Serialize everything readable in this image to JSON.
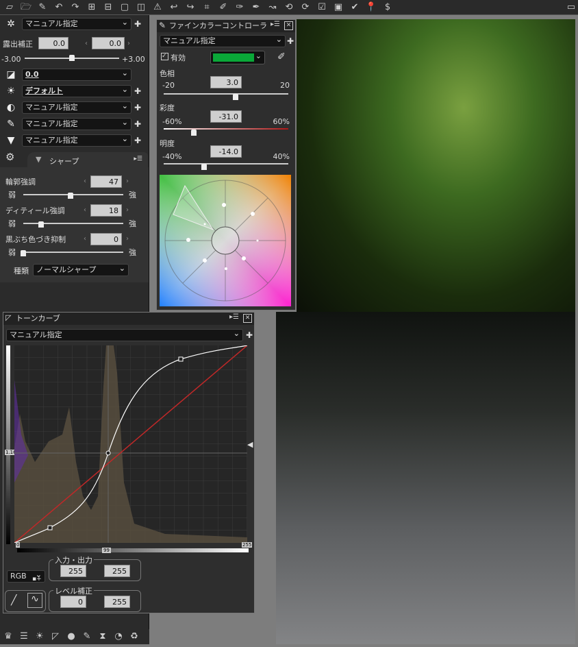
{
  "toolbar": {
    "icons": [
      "new-icon",
      "open-icon",
      "brush-icon",
      "undo-icon",
      "redo-icon",
      "grid4-icon",
      "grid2-icon",
      "single-view-icon",
      "split-view-icon",
      "warning-icon",
      "back-icon",
      "forward-icon",
      "crop-icon",
      "picker-icon",
      "picker2-icon",
      "pen-icon",
      "curve-icon",
      "rotate-left-icon",
      "rotate-right-icon",
      "check-icon",
      "save-icon",
      "approve-icon",
      "pin-icon",
      "dollar-icon",
      "monitor-icon"
    ]
  },
  "left": {
    "picture_control": "マニュアル指定",
    "exposure_label": "露出補正",
    "exposure_value1": "0.0",
    "exposure_value2": "0.0",
    "exposure_min": "-3.00",
    "exposure_max": "+3.00",
    "exposure_pos": 0.5,
    "exp_comp_select": "0.0",
    "wb_select": "デフォルト",
    "contrast_select": "マニュアル指定",
    "color_select": "マニュアル指定",
    "sharp_select": "マニュアル指定",
    "sharp_tab": "シャープ",
    "outline_label": "輪郭強調",
    "outline_value": "47",
    "outline_pos": 0.47,
    "detail_label": "ディティール強調",
    "detail_value": "18",
    "detail_pos": 0.18,
    "fringe_label": "黒ぶち色づき抑制",
    "fringe_value": "0",
    "fringe_pos": 0,
    "weak": "弱",
    "strong": "強",
    "type_label": "種類",
    "type_value": "ノーマルシャープ"
  },
  "fcc": {
    "title": "ファインカラーコントローラ",
    "preset": "マニュアル指定",
    "enabled_label": "有効",
    "swatch_color": "#0aa838",
    "hue_label": "色相",
    "hue_value": "3.0",
    "hue_min": "-20",
    "hue_max": "20",
    "hue_pos": 0.575,
    "sat_label": "彩度",
    "sat_value": "-31.0",
    "sat_min": "-60%",
    "sat_max": "60%",
    "sat_pos": 0.24,
    "bri_label": "明度",
    "bri_value": "-14.0",
    "bri_min": "-40%",
    "bri_max": "40%",
    "bri_pos": 0.325
  },
  "tone": {
    "title": "トーンカーブ",
    "preset": "マニュアル指定",
    "mid_marker": "1.16",
    "black_point": "0",
    "gray_point": "99",
    "white_point": "255",
    "channel": "RGB",
    "io_label": "入力・出力",
    "io_in": "255",
    "io_out": "255",
    "level_label": "レベル補正",
    "level_low": "0",
    "level_high": "255"
  }
}
